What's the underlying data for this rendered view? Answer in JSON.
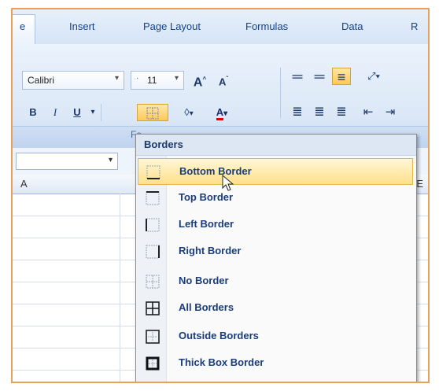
{
  "ribbon": {
    "tabs": [
      "e",
      "Insert",
      "Page Layout",
      "Formulas",
      "Data",
      "R"
    ],
    "font_name": "Calibri",
    "font_size": "11",
    "grow_font": "A",
    "shrink_font": "A",
    "bold": "B",
    "italic": "I",
    "underline": "U",
    "font_color_label": "A",
    "group_label": "Fo"
  },
  "grid": {
    "col_a": "A",
    "col_e": "E"
  },
  "menu": {
    "header": "Borders",
    "items": [
      {
        "label": "Bottom Border",
        "icon": "bottom-border-icon"
      },
      {
        "label": "Top Border",
        "icon": "top-border-icon"
      },
      {
        "label": "Left Border",
        "icon": "left-border-icon"
      },
      {
        "label": "Right Border",
        "icon": "right-border-icon"
      },
      {
        "label": "No Border",
        "icon": "no-border-icon"
      },
      {
        "label": "All Borders",
        "icon": "all-borders-icon"
      },
      {
        "label": "Outside Borders",
        "icon": "outside-borders-icon"
      },
      {
        "label": "Thick Box Border",
        "icon": "thick-box-border-icon"
      }
    ]
  },
  "colors": {
    "accent_highlight": "#ffe08a",
    "frame": "#e9a05a",
    "tab_text": "#15428b"
  }
}
